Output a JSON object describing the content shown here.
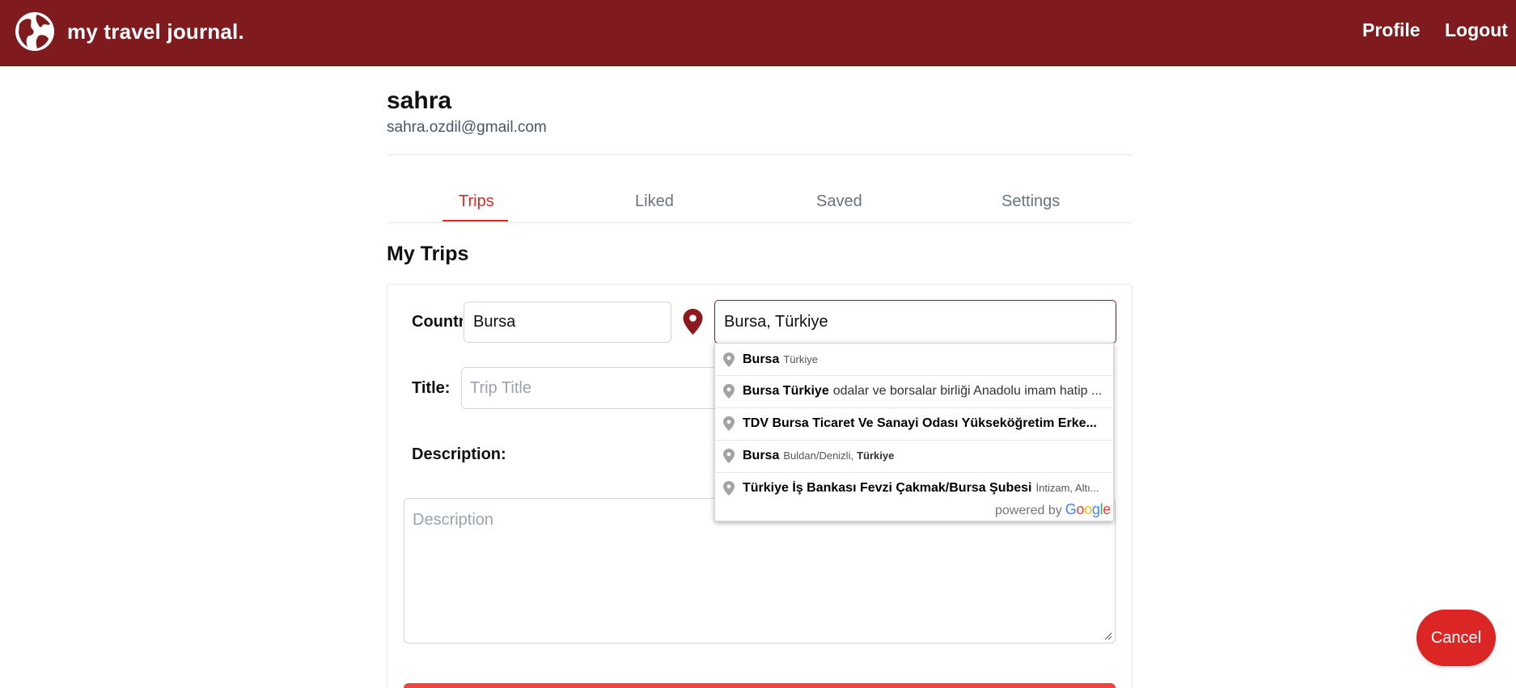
{
  "header": {
    "brand": "my travel journal.",
    "nav": {
      "profile": "Profile",
      "logout": "Logout"
    }
  },
  "user": {
    "name": "sahra",
    "email": "sahra.ozdil@gmail.com"
  },
  "tabs": [
    {
      "label": "Trips",
      "active": true
    },
    {
      "label": "Liked",
      "active": false
    },
    {
      "label": "Saved",
      "active": false
    },
    {
      "label": "Settings",
      "active": false
    }
  ],
  "section_title": "My Trips",
  "form": {
    "country_label": "Country:",
    "country_value": "Bursa",
    "location_value": "Bursa, Türkiye",
    "title_label": "Title:",
    "title_placeholder": "Trip Title",
    "description_label": "Description:",
    "description_placeholder": "Description"
  },
  "autocomplete": {
    "items": [
      {
        "main": "Bursa",
        "secondary": "Türkiye"
      },
      {
        "main": "Bursa Türkiye",
        "secondary": "odalar ve borsalar birliği Anadolu imam hatip ..."
      },
      {
        "main": "TDV Bursa Ticaret Ve Sanayi Odası Yükseköğretim Erke...",
        "secondary": ""
      },
      {
        "main": "Bursa",
        "secondary": "Buldan/Denizli,",
        "secondary_bold": "Türkiye"
      },
      {
        "main": "Türkiye İş Bankası Fevzi Çakmak/Bursa Şubesi",
        "secondary": "İntizam, Altı..."
      }
    ],
    "powered_by": "powered by",
    "google": [
      "G",
      "o",
      "o",
      "g",
      "l",
      "e"
    ]
  },
  "buttons": {
    "cancel": "Cancel"
  },
  "colors": {
    "header_bg": "#7f1b1e",
    "accent": "#dc2626",
    "pin": "#8b1a1e"
  }
}
